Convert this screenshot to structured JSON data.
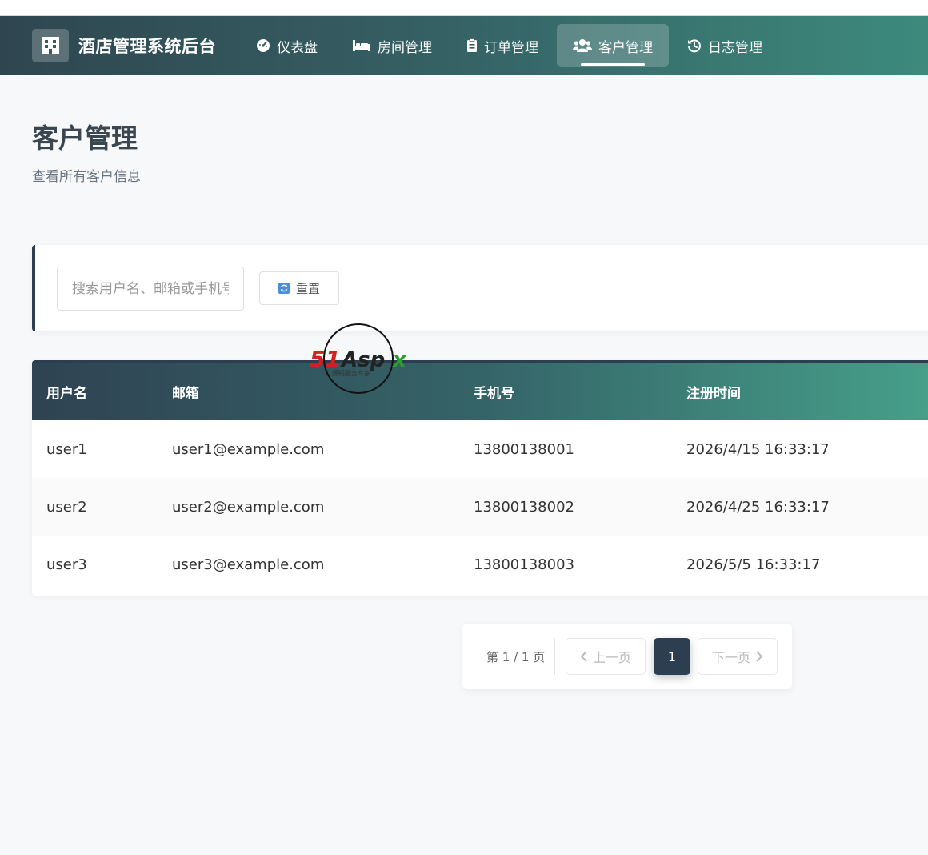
{
  "app": {
    "title": "酒店管理系统后台"
  },
  "nav": {
    "items": [
      {
        "label": "仪表盘",
        "icon": "dashboard-icon"
      },
      {
        "label": "房间管理",
        "icon": "bed-icon"
      },
      {
        "label": "订单管理",
        "icon": "clipboard-icon"
      },
      {
        "label": "客户管理",
        "icon": "users-icon",
        "active": true
      },
      {
        "label": "日志管理",
        "icon": "history-icon"
      }
    ]
  },
  "page": {
    "title": "客户管理",
    "subtitle": "查看所有客户信息"
  },
  "filter": {
    "search_placeholder": "搜索用户名、邮箱或手机号",
    "reset_label": "重置"
  },
  "table": {
    "headers": [
      "用户名",
      "邮箱",
      "手机号",
      "注册时间"
    ],
    "rows": [
      [
        "user1",
        "user1@example.com",
        "13800138001",
        "2026/4/15 16:33:17"
      ],
      [
        "user2",
        "user2@example.com",
        "13800138002",
        "2026/4/25 16:33:17"
      ],
      [
        "user3",
        "user3@example.com",
        "13800138003",
        "2026/5/5 16:33:17"
      ]
    ]
  },
  "pagination": {
    "info": "第 1 / 1 页",
    "prev_label": "上一页",
    "current_page": "1",
    "next_label": "下一页"
  },
  "watermark": {
    "text": "51Aspx",
    "tagline": "源码服务专家"
  },
  "colors": {
    "nav_start": "#2f4650",
    "nav_end": "#3d8a7d",
    "accent": "#2c3e50"
  }
}
